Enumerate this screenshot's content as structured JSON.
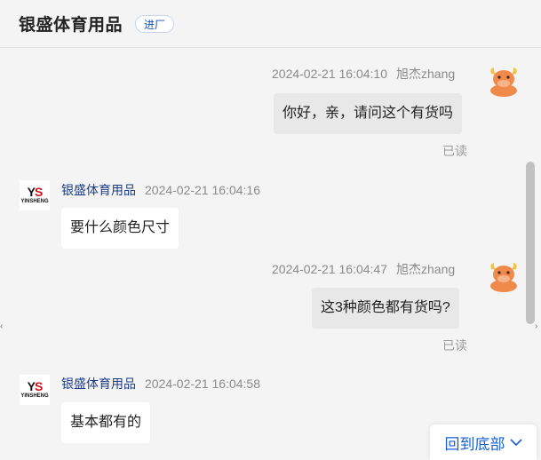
{
  "header": {
    "shop_name": "银盛体育用品",
    "badge": "进厂"
  },
  "messages": [
    {
      "side": "self",
      "time": "2024-02-21 16:04:10",
      "sender": "旭杰zhang",
      "text": "你好，亲，请问这个有货吗",
      "status": "已读"
    },
    {
      "side": "shop",
      "sender": "银盛体育用品",
      "time": "2024-02-21 16:04:16",
      "text": "要什么颜色尺寸"
    },
    {
      "side": "self",
      "time": "2024-02-21 16:04:47",
      "sender": "旭杰zhang",
      "text": "这3种颜色都有货吗?",
      "status": "已读"
    },
    {
      "side": "shop",
      "sender": "银盛体育用品",
      "time": "2024-02-21 16:04:58",
      "text": "基本都有的"
    }
  ],
  "shop_avatar": {
    "mark_y": "Y",
    "mark_s": "S",
    "sub": "YINSHENG"
  },
  "back_to_bottom": "回到底部",
  "colors": {
    "shop_name": "#1c3c84",
    "link": "#1a5fd0",
    "self_bubble": "#e8e8e8",
    "shop_bubble": "#ffffff",
    "avatar_orange": "#f08a4b"
  },
  "icons": {
    "user_avatar": "cartoon-bull-avatar-icon",
    "back_to_bottom": "chevron-down-icon"
  }
}
